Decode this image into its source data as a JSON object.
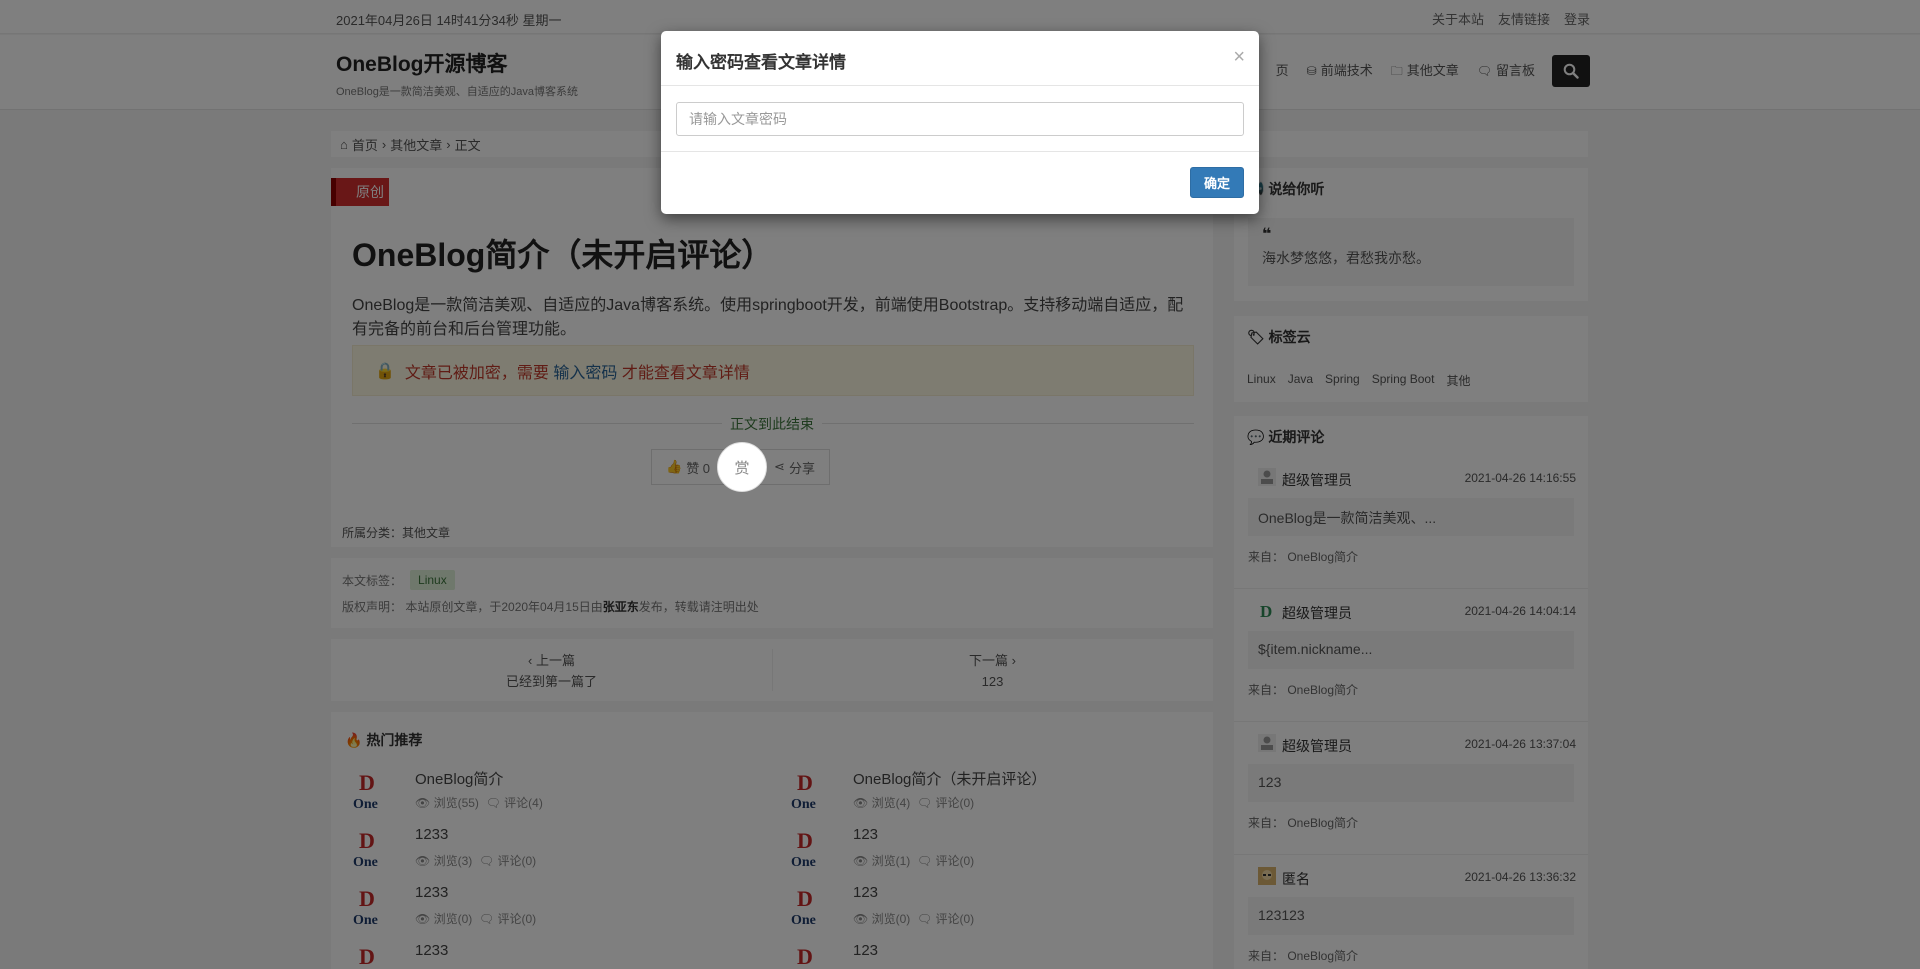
{
  "topbar": {
    "datetime": "2021年04月26日 14时41分34秒 星期一",
    "links": [
      "关于本站",
      "友情链接",
      "登录"
    ]
  },
  "header": {
    "site_title": "OneBlog开源博客",
    "site_subtitle": "OneBlog是一款简洁美观、自适应的Java博客系统",
    "nav": [
      "页",
      "前端技术",
      "其他文章",
      "留言板"
    ]
  },
  "breadcrumb": [
    "首页",
    "其他文章",
    "正文"
  ],
  "article": {
    "badge": "原创",
    "title": "OneBlog简介（未开启评论）",
    "description": "OneBlog是一款简洁美观、自适应的Java博客系统。使用springboot开发，前端使用Bootstrap。支持移动端自适应，配有完备的前台和后台管理功能。",
    "lock_text_before": "文章已被加密，需要",
    "lock_link": "输入密码",
    "lock_text_after": "才能查看文章详情",
    "end_text": "正文到此结束",
    "like_label": "赞 0",
    "reward_label": "赏",
    "share_label": "分享",
    "category_label": "所属分类：",
    "category": "其他文章"
  },
  "meta": {
    "tags_label": "本文标签：",
    "tag": "Linux",
    "copyright_label": "版权声明：",
    "copyright_before": "本站原创文章，于2020年04月15日由",
    "author": "张亚东",
    "copyright_after": "发布，转载请注明出处"
  },
  "pager": {
    "prev_label": "上一篇",
    "prev_title": "已经到第一篇了",
    "next_label": "下一篇",
    "next_title": "123"
  },
  "hot": {
    "title": "热门推荐",
    "items": [
      {
        "name": "OneBlog简介",
        "views": "浏览(55)",
        "comments": "评论(4)"
      },
      {
        "name": "OneBlog简介（未开启评论）",
        "views": "浏览(4)",
        "comments": "评论(0)"
      },
      {
        "name": "1233",
        "views": "浏览(3)",
        "comments": "评论(0)"
      },
      {
        "name": "123",
        "views": "浏览(1)",
        "comments": "评论(0)"
      },
      {
        "name": "1233",
        "views": "浏览(0)",
        "comments": "评论(0)"
      },
      {
        "name": "123",
        "views": "浏览(0)",
        "comments": "评论(0)"
      },
      {
        "name": "1233",
        "views": "",
        "comments": ""
      },
      {
        "name": "123",
        "views": "",
        "comments": ""
      }
    ]
  },
  "sidebar": {
    "say_title": "说给你听",
    "quote": "海水梦悠悠，君愁我亦愁。",
    "tags_title": "标签云",
    "tags": [
      "Linux",
      "Java",
      "Spring",
      "Spring Boot",
      "其他"
    ],
    "comments_title": "近期评论",
    "comments": [
      {
        "user": "超级管理员",
        "time": "2021-04-26 14:16:55",
        "body": "OneBlog是一款简洁美观、...",
        "from": "来自：  OneBlog简介"
      },
      {
        "user": "超级管理员",
        "time": "2021-04-26 14:04:14",
        "body": "${item.nickname...",
        "from": "来自：  OneBlog简介"
      },
      {
        "user": "超级管理员",
        "time": "2021-04-26 13:37:04",
        "body": "123",
        "from": "来自：  OneBlog简介"
      },
      {
        "user": "匿名",
        "time": "2021-04-26 13:36:32",
        "body": "123123",
        "from": "来自：  OneBlog简介"
      }
    ]
  },
  "modal": {
    "title": "输入密码查看文章详情",
    "close": "×",
    "input_placeholder": "请输入文章密码",
    "input_value": "",
    "ok_label": "确定"
  },
  "colors": {
    "accent": "#337ab7",
    "badge": "#d32f2f",
    "overlay": "rgba(0,0,0,0.5)"
  }
}
